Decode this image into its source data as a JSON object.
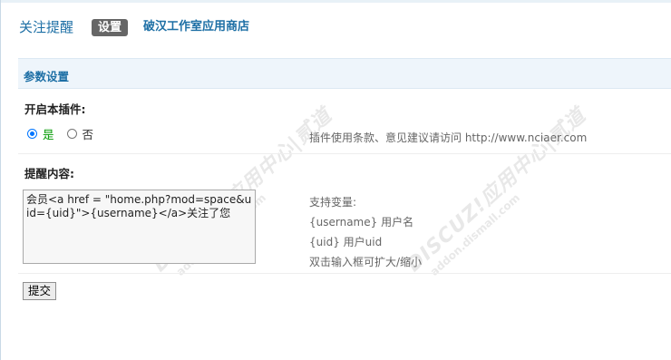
{
  "nav": {
    "title": "关注提醒",
    "active_tab": "设置",
    "store_link": "破汉工作室应用商店"
  },
  "section": {
    "title": "参数设置"
  },
  "plugin_enable": {
    "label": "开启本插件:",
    "options": [
      {
        "label": "是",
        "checked": true
      },
      {
        "label": "否",
        "checked": false
      }
    ],
    "tip": "插件使用条款、意见建议请访问 http://www.nciaer.com"
  },
  "reminder": {
    "label": "提醒内容:",
    "value": "会员<a href = \"home.php?mod=space&uid={uid}\">{username}</a>关注了您",
    "vars": [
      "支持变量:",
      "{username} 用户名",
      "{uid} 用户uid",
      "双击输入框可扩大/缩小"
    ]
  },
  "submit_label": "提交",
  "watermark": {
    "brand": "DISCUZ!应用中心|贰道",
    "url": "addon.dismall.com"
  },
  "colors": {
    "link_blue": "#1d6fa5",
    "section_bg": "#eef5fb",
    "yes_green": "#009900",
    "tab_bg": "#666666"
  }
}
